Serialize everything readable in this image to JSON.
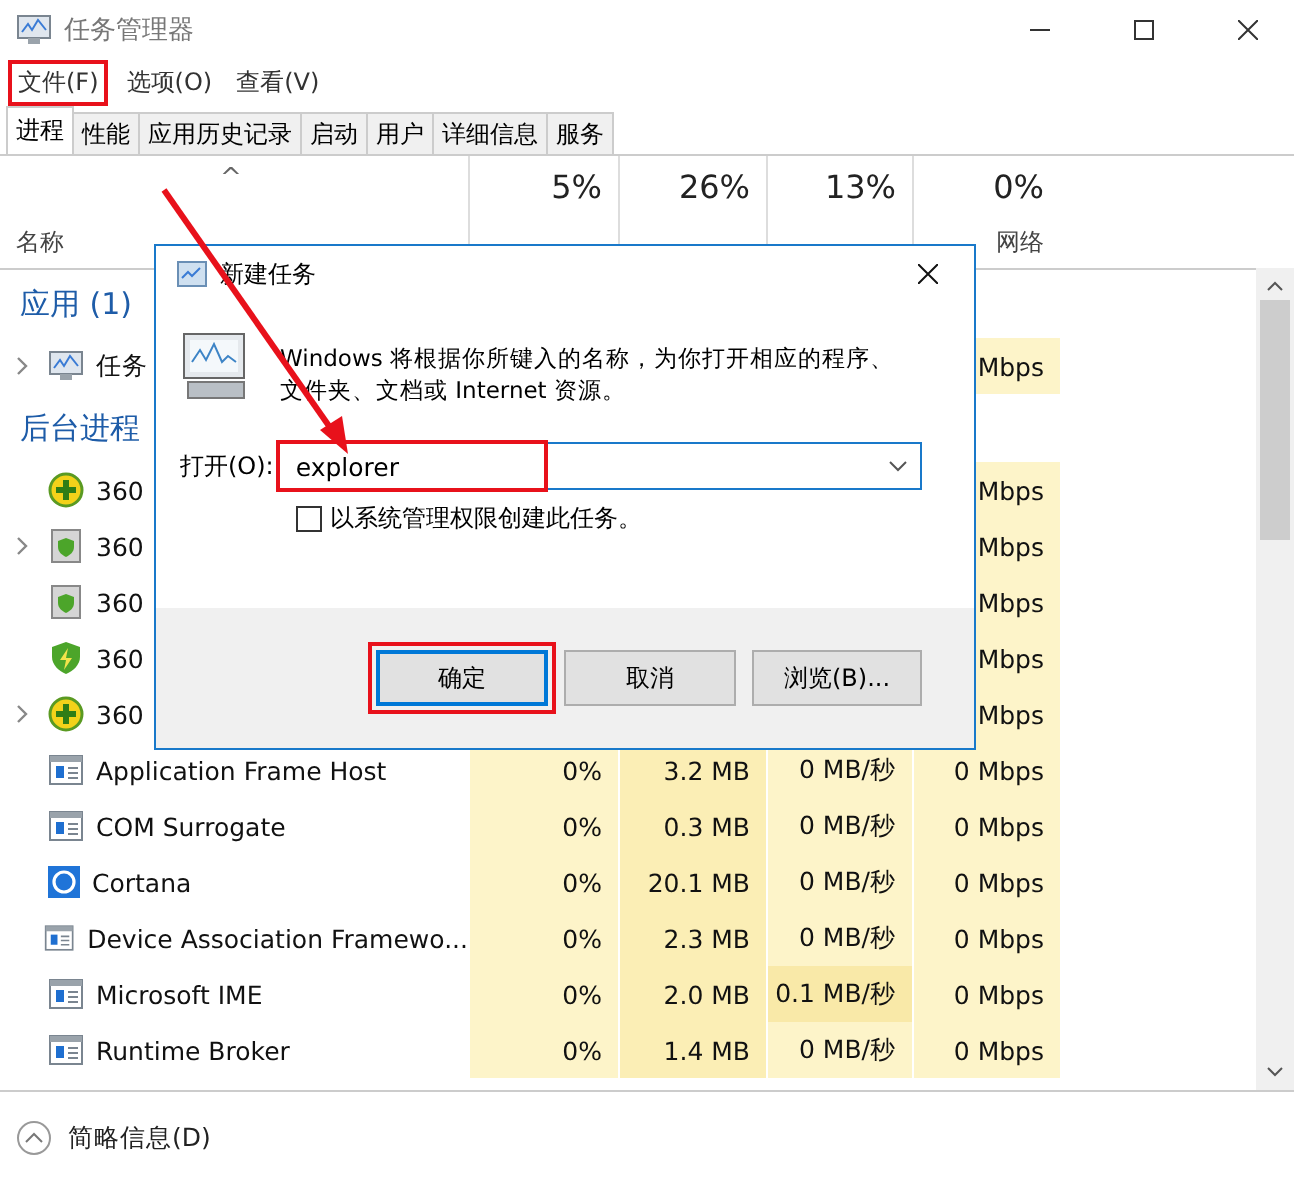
{
  "window": {
    "title": "任务管理器"
  },
  "menu": [
    {
      "label": "文件(F)",
      "annotated": true
    },
    {
      "label": "选项(O)",
      "annotated": false
    },
    {
      "label": "查看(V)",
      "annotated": false
    }
  ],
  "tabs": [
    {
      "label": "进程",
      "selected": true
    },
    {
      "label": "性能",
      "selected": false
    },
    {
      "label": "应用历史记录",
      "selected": false
    },
    {
      "label": "启动",
      "selected": false
    },
    {
      "label": "用户",
      "selected": false
    },
    {
      "label": "详细信息",
      "selected": false
    },
    {
      "label": "服务",
      "selected": false
    }
  ],
  "table": {
    "name_header": "名称",
    "sort_caret": "^",
    "columns": [
      {
        "percent": "5%"
      },
      {
        "percent": "26%"
      },
      {
        "percent": "13%"
      },
      {
        "percent": "0%",
        "label": "网络"
      }
    ],
    "groups": [
      {
        "title": "应用 (1)",
        "rows": [
          {
            "name": "任务",
            "kind": "monitor",
            "expandable": true,
            "network": "Mbps"
          }
        ]
      },
      {
        "title": "后台进程",
        "rows": [
          {
            "name": "360",
            "kind": "plus",
            "expandable": false,
            "network": "Mbps"
          },
          {
            "name": "360",
            "kind": "shield",
            "expandable": true,
            "network": "Mbps"
          },
          {
            "name": "360",
            "kind": "shield",
            "expandable": false,
            "network": "Mbps"
          },
          {
            "name": "360",
            "kind": "bolt",
            "expandable": false,
            "network": "Mbps"
          },
          {
            "name": "360",
            "kind": "plus",
            "expandable": true,
            "network": "Mbps"
          },
          {
            "name": "Application Frame Host",
            "kind": "window",
            "expandable": false,
            "cpu": "0%",
            "memory": "3.2 MB",
            "disk": "0 MB/秒",
            "network": "0 Mbps",
            "disk_highlighted": false
          },
          {
            "name": "COM Surrogate",
            "kind": "window",
            "expandable": false,
            "cpu": "0%",
            "memory": "0.3 MB",
            "disk": "0 MB/秒",
            "network": "0 Mbps",
            "disk_highlighted": false
          },
          {
            "name": "Cortana",
            "kind": "ring",
            "expandable": false,
            "cpu": "0%",
            "memory": "20.1 MB",
            "disk": "0 MB/秒",
            "network": "0 Mbps",
            "disk_highlighted": false
          },
          {
            "name": "Device Association Framewo...",
            "kind": "window",
            "expandable": false,
            "cpu": "0%",
            "memory": "2.3 MB",
            "disk": "0 MB/秒",
            "network": "0 Mbps",
            "disk_highlighted": false
          },
          {
            "name": "Microsoft IME",
            "kind": "window",
            "expandable": false,
            "cpu": "0%",
            "memory": "2.0 MB",
            "disk": "0.1 MB/秒",
            "network": "0 Mbps",
            "disk_highlighted": true
          },
          {
            "name": "Runtime Broker",
            "kind": "window",
            "expandable": false,
            "cpu": "0%",
            "memory": "1.4 MB",
            "disk": "0 MB/秒",
            "network": "0 Mbps",
            "disk_highlighted": false
          }
        ]
      }
    ]
  },
  "footer": {
    "label": "简略信息(D)"
  },
  "dialog": {
    "title": "新建任务",
    "description": "Windows 将根据你所键入的名称，为你打开相应的程序、文件夹、文档或 Internet 资源。",
    "open_label": "打开(O):",
    "open_value": "explorer",
    "open_annotated": true,
    "checkbox": {
      "label": "以系统管理权限创建此任务。",
      "checked": false
    },
    "buttons": [
      {
        "label": "确定",
        "default": true,
        "annotated": true
      },
      {
        "label": "取消",
        "default": false,
        "annotated": false
      },
      {
        "label": "浏览(B)...",
        "default": false,
        "annotated": false
      }
    ]
  }
}
